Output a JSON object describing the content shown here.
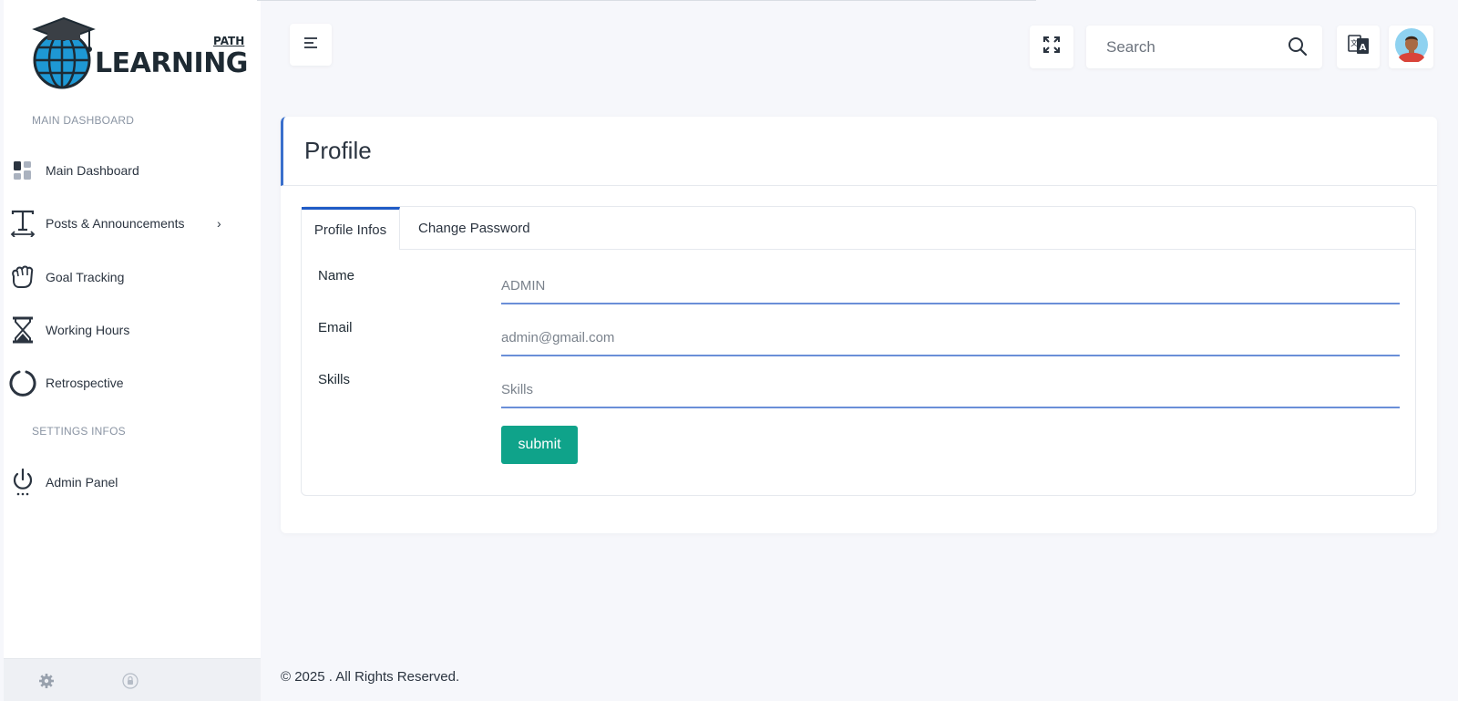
{
  "brand": {
    "logo_main": "LEARNING",
    "logo_sub": "PATH"
  },
  "sidebar": {
    "section_main": "MAIN DASHBOARD",
    "section_settings": "SETTINGS INFOS",
    "items": [
      {
        "label": "Main Dashboard",
        "icon": "dashboard-grid-icon"
      },
      {
        "label": "Posts & Announcements",
        "icon": "text-icon",
        "chevron": "›"
      },
      {
        "label": "Goal Tracking",
        "icon": "hand-icon"
      },
      {
        "label": "Working Hours",
        "icon": "hourglass-icon"
      },
      {
        "label": "Retrospective",
        "icon": "circle-progress-icon"
      }
    ],
    "settings_items": [
      {
        "label": "Admin Panel",
        "icon": "power-icon"
      }
    ]
  },
  "header": {
    "search_placeholder": "Search"
  },
  "card": {
    "title": "Profile",
    "tabs": [
      {
        "label": "Profile Infos",
        "active": true
      },
      {
        "label": "Change Password",
        "active": false
      }
    ],
    "fields": [
      {
        "label": "Name",
        "placeholder": "ADMIN",
        "value": ""
      },
      {
        "label": "Email",
        "placeholder": "admin@gmail.com",
        "value": ""
      },
      {
        "label": "Skills",
        "placeholder": "Skills",
        "value": ""
      }
    ],
    "submit_label": "submit"
  },
  "footer": {
    "copyright": "© 2025 . All Rights Reserved."
  },
  "colors": {
    "accent": "#1f5bc6",
    "input_underline": "#6a8fd8",
    "submit_bg": "#0fa38a",
    "page_bg": "#f6f7fb",
    "text": "#2b3440"
  }
}
